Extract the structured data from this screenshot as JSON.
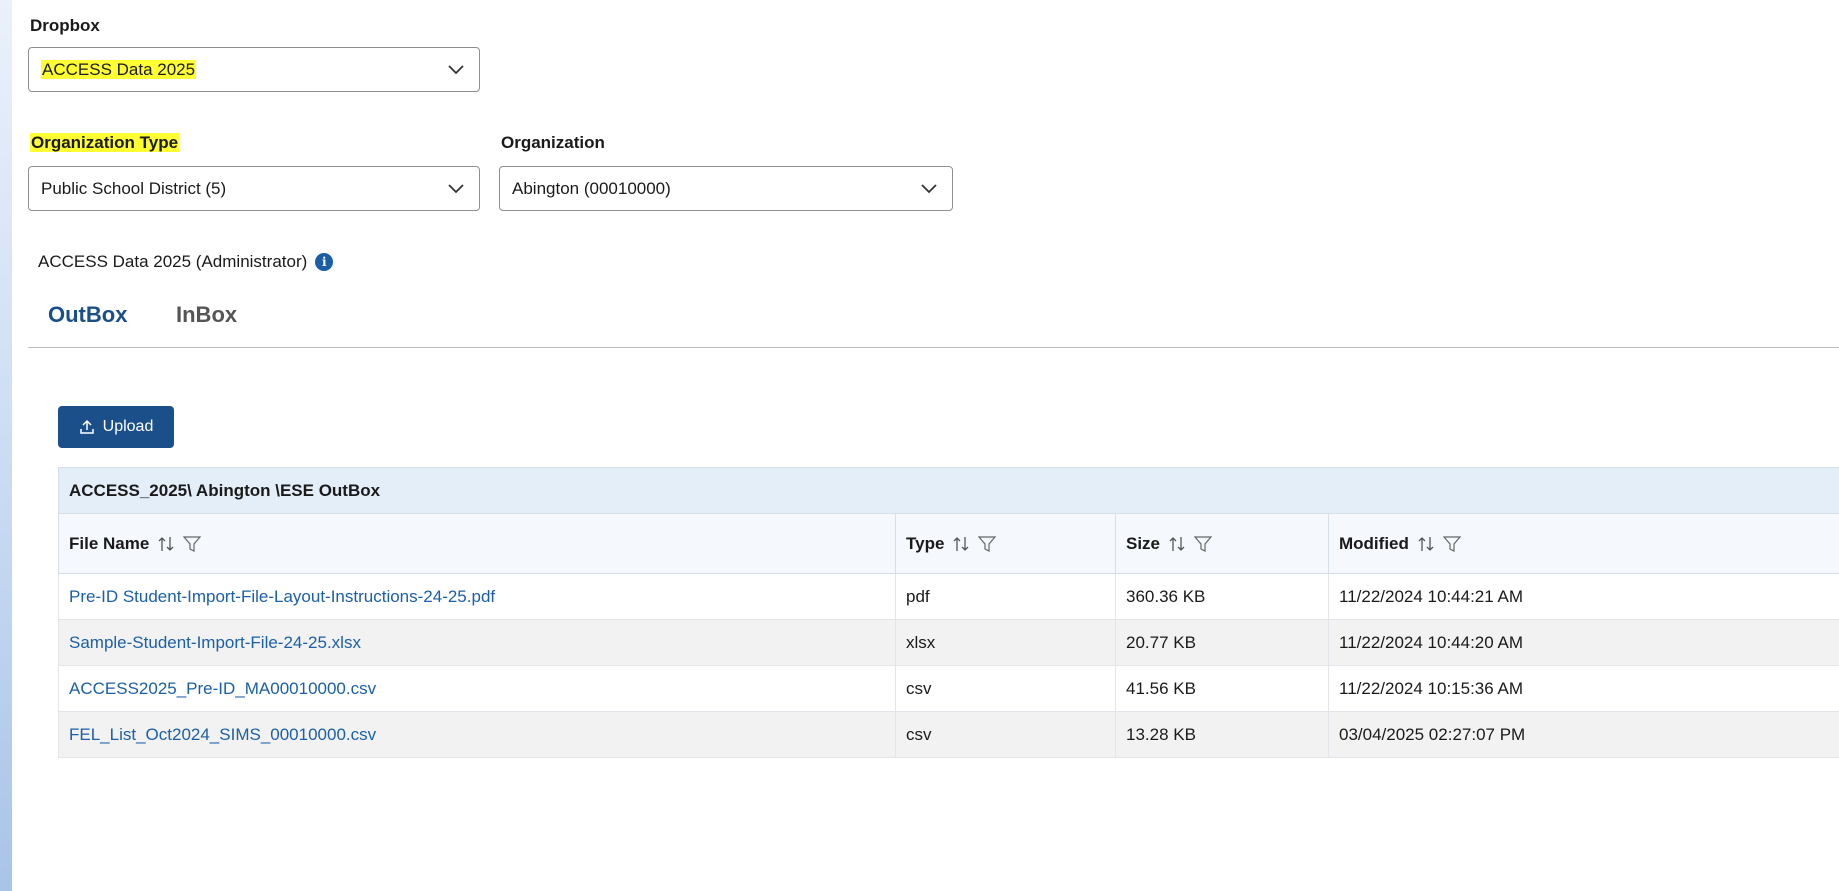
{
  "dropbox": {
    "label": "Dropbox",
    "selected": "ACCESS Data 2025"
  },
  "organization_type": {
    "label": "Organization Type",
    "selected": "Public School District (5)"
  },
  "organization": {
    "label": "Organization",
    "selected": "Abington (00010000)"
  },
  "role_line": "ACCESS Data 2025 (Administrator)",
  "tabs": [
    {
      "label": "OutBox",
      "active": true
    },
    {
      "label": "InBox",
      "active": false
    }
  ],
  "upload_button": "Upload",
  "table": {
    "path": "ACCESS_2025\\ Abington \\ESE OutBox",
    "columns": [
      "File Name",
      "Type",
      "Size",
      "Modified"
    ],
    "rows": [
      {
        "name": "Pre-ID Student-Import-File-Layout-Instructions-24-25.pdf",
        "type": "pdf",
        "size": "360.36 KB",
        "modified": "11/22/2024 10:44:21 AM"
      },
      {
        "name": "Sample-Student-Import-File-24-25.xlsx",
        "type": "xlsx",
        "size": "20.77 KB",
        "modified": "11/22/2024 10:44:20 AM"
      },
      {
        "name": "ACCESS2025_Pre-ID_MA00010000.csv",
        "type": "csv",
        "size": "41.56 KB",
        "modified": "11/22/2024 10:15:36 AM"
      },
      {
        "name": "FEL_List_Oct2024_SIMS_00010000.csv",
        "type": "csv",
        "size": "13.28 KB",
        "modified": "03/04/2025 02:27:07 PM"
      }
    ]
  },
  "icons": {
    "chevron": "chevron-down-icon",
    "info": "info-icon",
    "upload": "upload-icon",
    "sort": "sort-icon",
    "filter": "filter-icon"
  },
  "colors": {
    "accent": "#1b4f8a",
    "link": "#1b5fa8",
    "highlight": "#ffff33"
  }
}
